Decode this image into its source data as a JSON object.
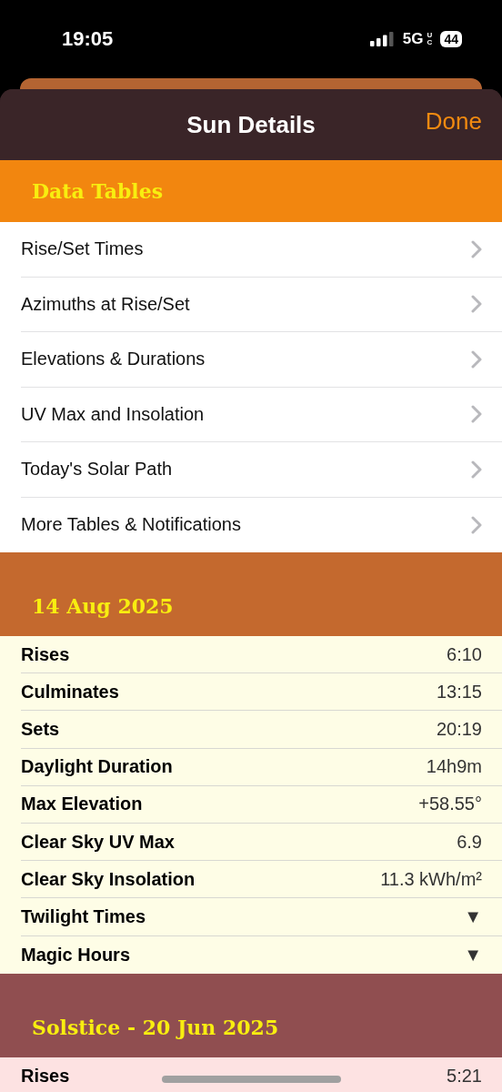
{
  "status_bar": {
    "time": "19:05",
    "network": "5G",
    "network_sub": "UC",
    "battery": "44"
  },
  "nav": {
    "title": "Sun Details",
    "done": "Done"
  },
  "sections": [
    {
      "kind": "links",
      "title": "Data Tables",
      "color": "#f2860f",
      "body": {
        "color": "#ffffff",
        "rows": [
          {
            "label": "Rise/Set Times"
          },
          {
            "label": "Azimuths at Rise/Set"
          },
          {
            "label": "Elevations & Durations"
          },
          {
            "label": "UV Max and Insolation"
          },
          {
            "label": "Today's Solar Path"
          },
          {
            "label": "More Tables & Notifications"
          }
        ]
      }
    },
    {
      "kind": "values",
      "title": "14 Aug 2025",
      "color": "#c4692e",
      "body": {
        "color": "#fefde6",
        "rows": [
          {
            "label": "Rises",
            "value": "6:10"
          },
          {
            "label": "Culminates",
            "value": "13:15"
          },
          {
            "label": "Sets",
            "value": "20:19"
          },
          {
            "label": "Daylight Duration",
            "value": "14h9m"
          },
          {
            "label": "Max Elevation",
            "value": "+58.55°"
          },
          {
            "label": "Clear Sky UV Max",
            "value": "6.9"
          },
          {
            "label": "Clear Sky Insolation",
            "value": "11.3 kWh/m²"
          },
          {
            "label": "Twilight Times",
            "value": "▼"
          },
          {
            "label": "Magic Hours",
            "value": "▼"
          }
        ]
      }
    },
    {
      "kind": "values",
      "title": "Solstice - 20 Jun 2025",
      "color": "#904e50",
      "body": {
        "color": "#fde2e2",
        "rows": [
          {
            "label": "Rises",
            "value": "5:21"
          }
        ]
      }
    }
  ]
}
